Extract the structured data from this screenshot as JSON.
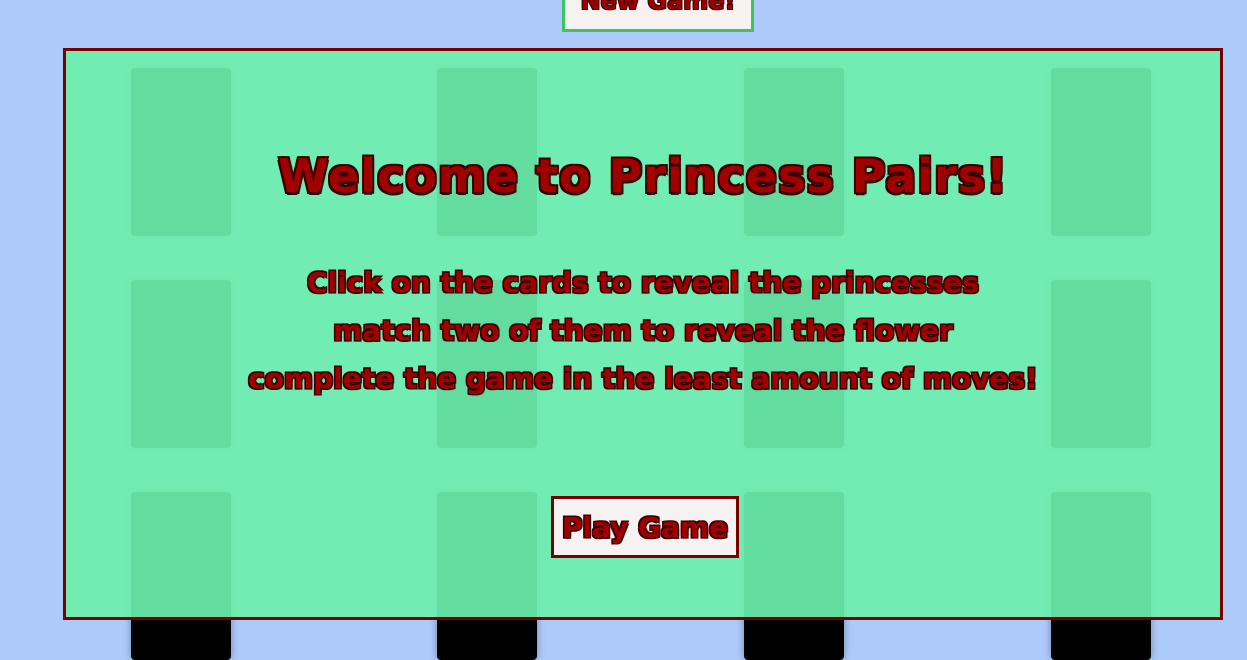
{
  "header": {
    "new_game_label": "New Game!"
  },
  "board": {
    "card_count": 12
  },
  "welcome": {
    "title": "Welcome to Princess Pairs!",
    "instructions": [
      "Click on the cards to reveal the princesses",
      "match two of them to reveal the flower",
      "complete the game in the least amount of moves!"
    ],
    "play_label": "Play Game"
  },
  "colors": {
    "background": "#aecafb",
    "overlay": "#6befac",
    "border": "#7a0000",
    "text": "#a00000",
    "card_back": "#000000"
  }
}
